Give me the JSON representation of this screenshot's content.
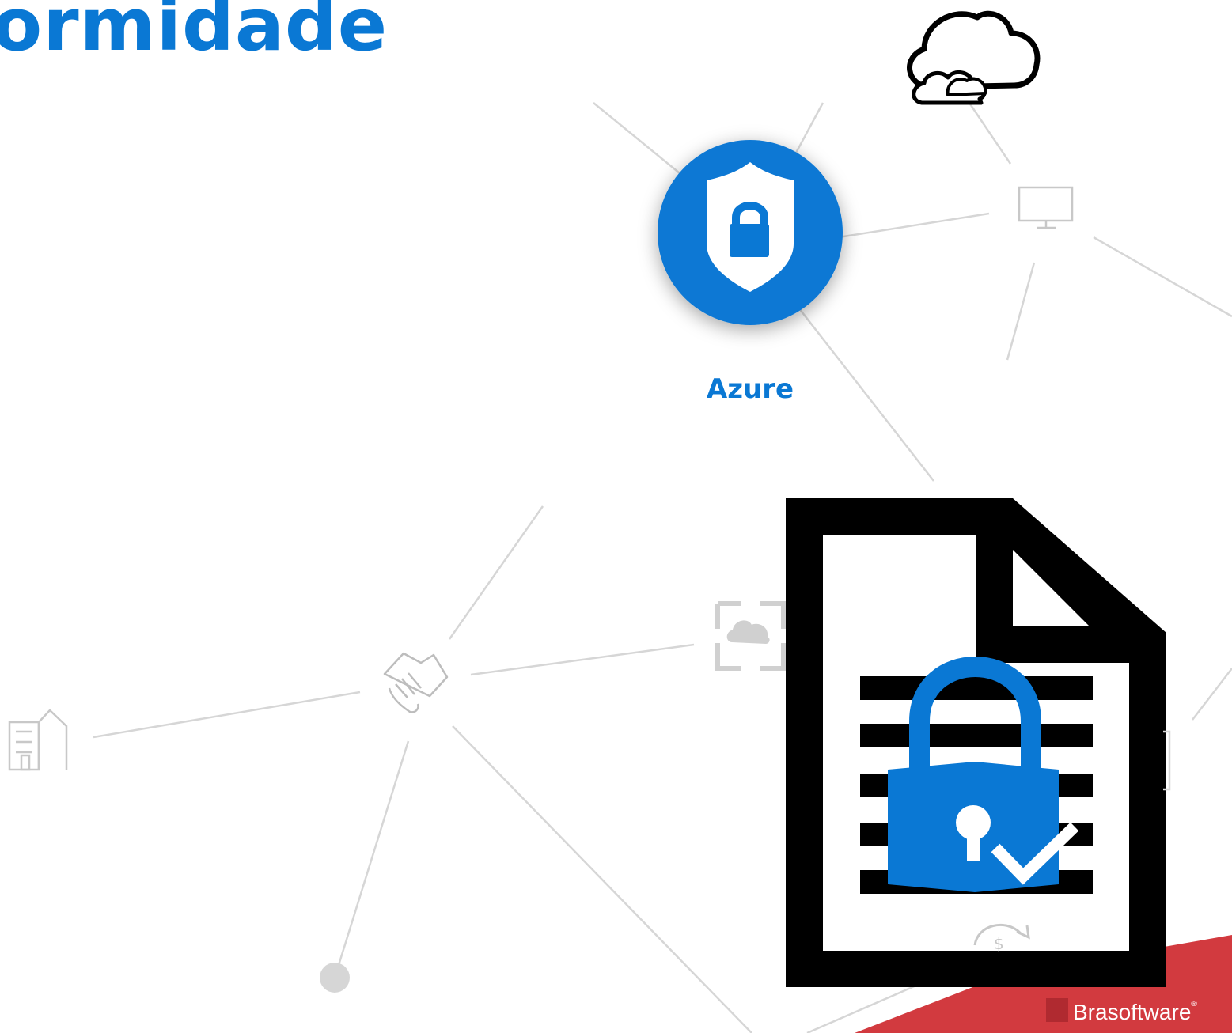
{
  "header": {
    "title": "ormidade"
  },
  "center_node": {
    "label": "Azure",
    "icon": "shield-lock-icon"
  },
  "brand": {
    "name": "Brasoftware",
    "mark": "®"
  },
  "colors": {
    "accent": "#0a78d4",
    "lines": "#d6d6d6",
    "brand_red": "#d23a3f"
  },
  "icons": [
    "cloud-icon",
    "monitor-icon",
    "handshake-icon",
    "building-icon",
    "cloud-grid-icon",
    "document-lock-icon",
    "dollar-cycle-icon"
  ]
}
